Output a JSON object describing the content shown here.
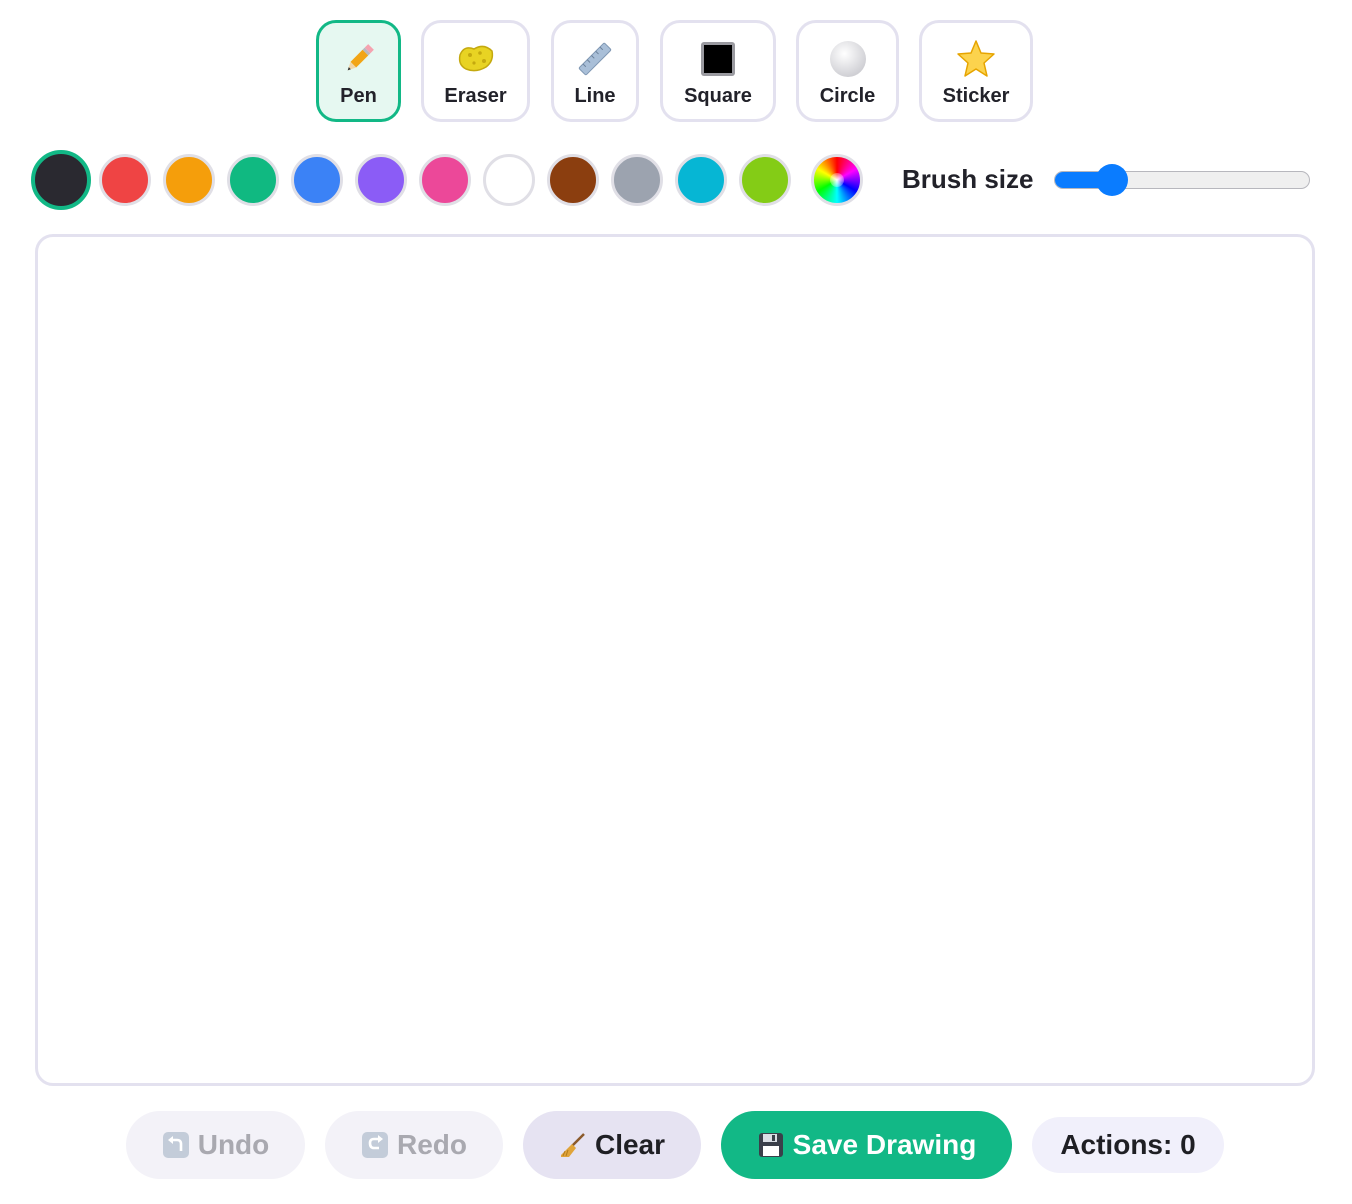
{
  "tools": [
    {
      "label": "Pen",
      "icon": "pencil-icon",
      "active": true
    },
    {
      "label": "Eraser",
      "icon": "sponge-icon",
      "active": false
    },
    {
      "label": "Line",
      "icon": "ruler-icon",
      "active": false
    },
    {
      "label": "Square",
      "icon": "black-square-icon",
      "active": false
    },
    {
      "label": "Circle",
      "icon": "white-circle-icon",
      "active": false
    },
    {
      "label": "Sticker",
      "icon": "star-icon",
      "active": false
    }
  ],
  "colors": [
    {
      "name": "black",
      "hex": "#2a2930",
      "selected": true
    },
    {
      "name": "red",
      "hex": "#ef4444",
      "selected": false
    },
    {
      "name": "orange",
      "hex": "#f59e0b",
      "selected": false
    },
    {
      "name": "green",
      "hex": "#10b981",
      "selected": false
    },
    {
      "name": "blue",
      "hex": "#3b82f6",
      "selected": false
    },
    {
      "name": "purple",
      "hex": "#8b5cf6",
      "selected": false
    },
    {
      "name": "pink",
      "hex": "#ec4899",
      "selected": false
    },
    {
      "name": "white",
      "hex": "#ffffff",
      "selected": false
    },
    {
      "name": "brown",
      "hex": "#8b3e0f",
      "selected": false
    },
    {
      "name": "gray",
      "hex": "#9ca3af",
      "selected": false
    },
    {
      "name": "cyan",
      "hex": "#06b6d4",
      "selected": false
    },
    {
      "name": "lime",
      "hex": "#84cc16",
      "selected": false
    },
    {
      "name": "custom",
      "hex": "rainbow",
      "selected": false
    }
  ],
  "brush": {
    "label": "Brush size",
    "value_fraction": 0.15
  },
  "buttons": {
    "undo": "Undo",
    "redo": "Redo",
    "clear": "Clear",
    "save": "Save Drawing"
  },
  "actions": "Actions: 0",
  "accent_color": "#12b886"
}
